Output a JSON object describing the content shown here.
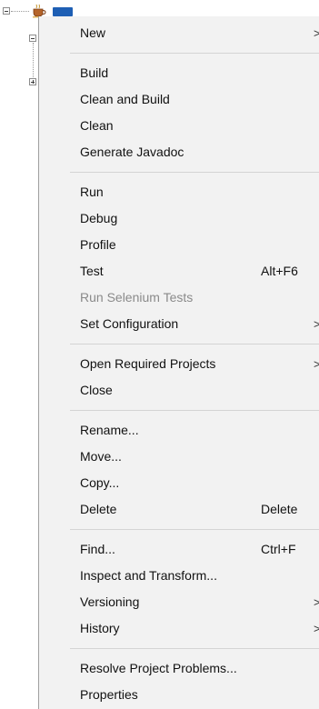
{
  "tree": {
    "project_icon": "coffee-cup-project-icon",
    "selected_label_color": "#1e5fb4"
  },
  "menu": {
    "groups": [
      [
        {
          "label": "New",
          "shortcut": "",
          "submenu": true,
          "enabled": true
        }
      ],
      [
        {
          "label": "Build",
          "shortcut": "",
          "submenu": false,
          "enabled": true
        },
        {
          "label": "Clean and Build",
          "shortcut": "",
          "submenu": false,
          "enabled": true
        },
        {
          "label": "Clean",
          "shortcut": "",
          "submenu": false,
          "enabled": true
        },
        {
          "label": "Generate Javadoc",
          "shortcut": "",
          "submenu": false,
          "enabled": true
        }
      ],
      [
        {
          "label": "Run",
          "shortcut": "",
          "submenu": false,
          "enabled": true
        },
        {
          "label": "Debug",
          "shortcut": "",
          "submenu": false,
          "enabled": true
        },
        {
          "label": "Profile",
          "shortcut": "",
          "submenu": false,
          "enabled": true
        },
        {
          "label": "Test",
          "shortcut": "Alt+F6",
          "submenu": false,
          "enabled": true
        },
        {
          "label": "Run Selenium Tests",
          "shortcut": "",
          "submenu": false,
          "enabled": false
        },
        {
          "label": "Set Configuration",
          "shortcut": "",
          "submenu": true,
          "enabled": true
        }
      ],
      [
        {
          "label": "Open Required Projects",
          "shortcut": "",
          "submenu": true,
          "enabled": true
        },
        {
          "label": "Close",
          "shortcut": "",
          "submenu": false,
          "enabled": true
        }
      ],
      [
        {
          "label": "Rename...",
          "shortcut": "",
          "submenu": false,
          "enabled": true
        },
        {
          "label": "Move...",
          "shortcut": "",
          "submenu": false,
          "enabled": true
        },
        {
          "label": "Copy...",
          "shortcut": "",
          "submenu": false,
          "enabled": true
        },
        {
          "label": "Delete",
          "shortcut": "Delete",
          "submenu": false,
          "enabled": true
        }
      ],
      [
        {
          "label": "Find...",
          "shortcut": "Ctrl+F",
          "submenu": false,
          "enabled": true
        },
        {
          "label": "Inspect and Transform...",
          "shortcut": "",
          "submenu": false,
          "enabled": true
        },
        {
          "label": "Versioning",
          "shortcut": "",
          "submenu": true,
          "enabled": true
        },
        {
          "label": "History",
          "shortcut": "",
          "submenu": true,
          "enabled": true
        }
      ],
      [
        {
          "label": "Resolve Project Problems...",
          "shortcut": "",
          "submenu": false,
          "enabled": true
        },
        {
          "label": "Properties",
          "shortcut": "",
          "submenu": false,
          "enabled": true
        }
      ]
    ],
    "submenu_arrow": ">"
  }
}
